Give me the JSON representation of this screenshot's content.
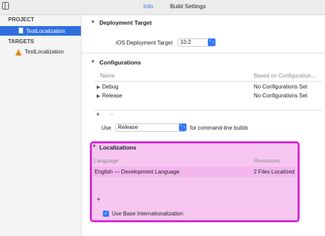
{
  "tabs": {
    "info": "Info",
    "build_settings": "Build Settings"
  },
  "sidebar": {
    "project_header": "PROJECT",
    "project_item": "TestLocalization",
    "targets_header": "TARGETS",
    "target_item": "TestLocalization"
  },
  "deployment": {
    "title": "Deployment Target",
    "label": "iOS Deployment Target",
    "value": "10.2"
  },
  "configurations": {
    "title": "Configurations",
    "col_name": "Name",
    "col_based": "Based on Configuration...",
    "rows": [
      {
        "name": "Debug",
        "value": "No Configurations Set"
      },
      {
        "name": "Release",
        "value": "No Configurations Set"
      }
    ],
    "use_label": "Use",
    "use_value": "Release",
    "use_suffix": "for command-line builds",
    "plus": "+",
    "minus": "−"
  },
  "localizations": {
    "title": "Localizations",
    "col_language": "Language",
    "col_resources": "Resources",
    "row_language": "English — Development Language",
    "row_resources": "2 Files Localized",
    "plus": "+",
    "minus": "−",
    "base_checkbox_label": "Use Base Internationalization",
    "base_checked": true
  },
  "colors": {
    "accent": "#2f6fde",
    "highlight_border": "#d629d6",
    "highlight_fill": "#f7c7f2"
  }
}
